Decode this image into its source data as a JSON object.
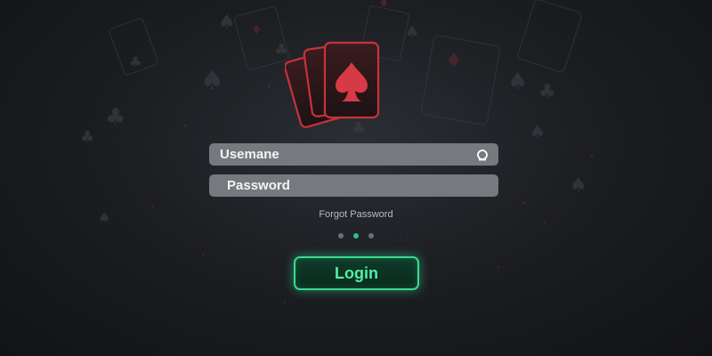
{
  "login_form": {
    "username_placeholder": "Usemane",
    "password_placeholder": "Password",
    "forgot_password": "Forgot Password",
    "login_label": "Login"
  },
  "pagination": {
    "total": 3,
    "active_index": 1
  },
  "icons": {
    "logo": "spade-cards-icon",
    "username_icon": "user-icon"
  },
  "colors": {
    "accent_green": "#39d98f",
    "logo_red": "#c8323c",
    "field_bg": "#76797d"
  }
}
